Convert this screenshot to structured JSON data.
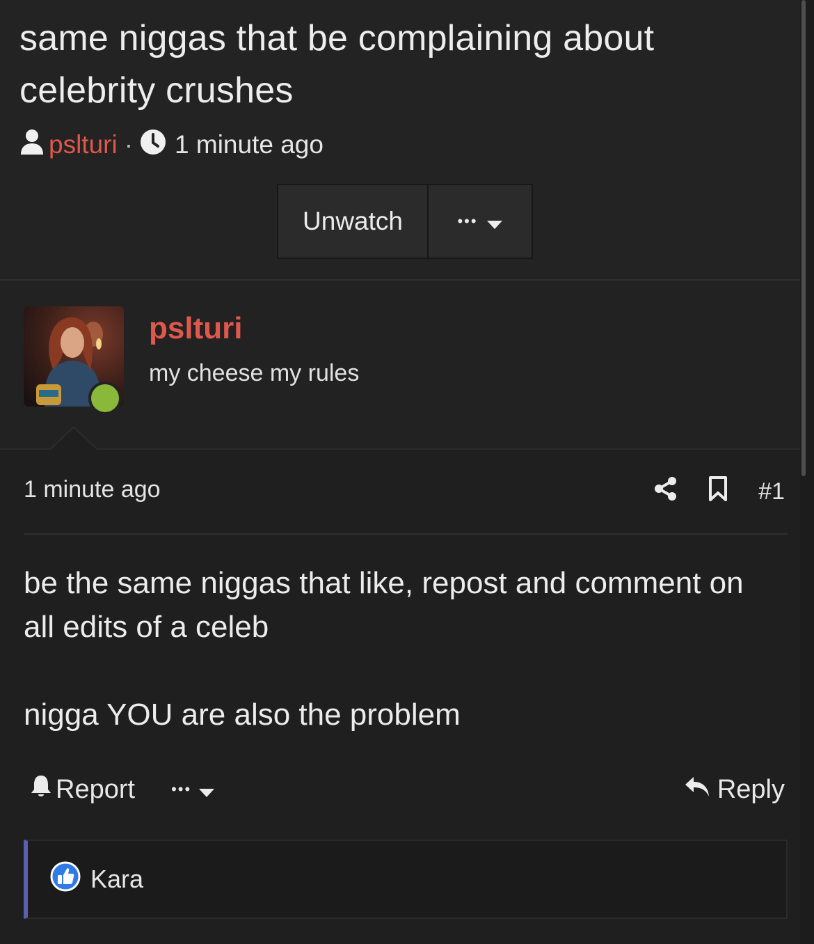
{
  "thread": {
    "title": "same niggas that be complaining about celebrity crushes",
    "author": "pslturi",
    "separator": "·",
    "time": "1 minute ago",
    "unwatch_label": "Unwatch",
    "more_label": "•••"
  },
  "user": {
    "name": "pslturi",
    "title": "my cheese my rules",
    "status": "online"
  },
  "post": {
    "time": "1 minute ago",
    "number": "#1",
    "paragraphs": [
      "be the same niggas that like, repost and comment on all edits of a celeb",
      "nigga YOU are also the problem"
    ]
  },
  "footer": {
    "report_label": "Report",
    "more_label": "•••",
    "reply_label": "Reply"
  },
  "reactions": {
    "users": [
      "Kara"
    ],
    "icon": "thumbs-up-icon"
  },
  "colors": {
    "background": "#1f1f1f",
    "author_accent": "#e0574b",
    "online": "#8ab83b",
    "reaction_bar": "#5a5fb0",
    "like_blue": "#2f7ae5"
  }
}
